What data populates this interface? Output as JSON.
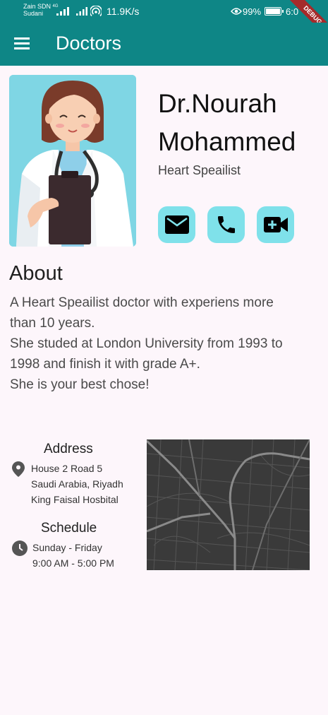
{
  "status_bar": {
    "carrier_line1": "Zain SDN",
    "carrier_line2": "Sudani",
    "network": "4G",
    "speed": "11.9K/s",
    "battery": "99%",
    "time": "6:0",
    "debug_banner": "DEBUG"
  },
  "app_bar": {
    "menu_icon": "hamburger-menu",
    "title": "Doctors"
  },
  "doctor": {
    "name_line1": "Dr.Nourah",
    "name_line2": "Mohammed",
    "specialty": "Heart Speailist",
    "actions": [
      {
        "icon": "mail-icon"
      },
      {
        "icon": "phone-icon"
      },
      {
        "icon": "video-call-icon"
      }
    ]
  },
  "about": {
    "title": "About",
    "line1": "A Heart Speailist doctor with experiens more",
    "line2": "than 10 years.",
    "line3": "She studed at London University from 1993 to",
    "line4": "1998 and finish it with grade A+.",
    "line5": "She is your best chose!"
  },
  "address": {
    "title": "Address",
    "line1": "House 2 Road 5",
    "line2": "Saudi Arabia, Riyadh",
    "line3": "King Faisal Hosbital"
  },
  "schedule": {
    "title": "Schedule",
    "days": "Sunday - Friday",
    "hours": "9:00 AM - 5:00 PM"
  },
  "colors": {
    "primary": "#0e8686",
    "accent": "#7fe1ea",
    "background": "#fdf6fb",
    "map": "#3a3a3a"
  }
}
